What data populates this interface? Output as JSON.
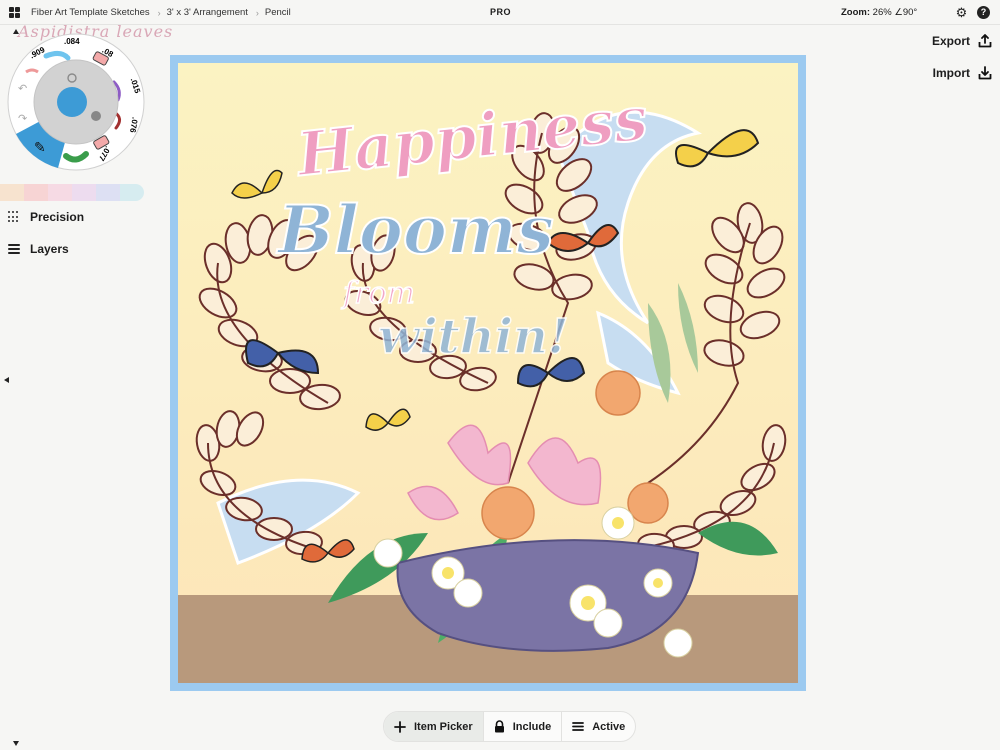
{
  "topbar": {
    "breadcrumbs": [
      "Fiber Art Template Sketches",
      "3' x 3' Arrangement",
      "Pencil"
    ],
    "badge": "PRO",
    "zoom_label": "Zoom:",
    "zoom_value": "26%",
    "rotation": "∠90°"
  },
  "toolwheel": {
    "brush_name": "Aspidistra leaves",
    "sizes": {
      "top_left": ".909",
      "top": ".084",
      "top_right": ".08",
      "right_upper": ".015",
      "right_lower": ".076",
      "bottom_right": ".077"
    }
  },
  "palette_colors": [
    "#f7e3cf",
    "#f7d4d4",
    "#f6dae4",
    "#eddcef",
    "#dde0f3",
    "#d6ecf0"
  ],
  "sidebar": {
    "precision_label": "Precision",
    "layers_label": "Layers"
  },
  "actions": {
    "export_label": "Export",
    "import_label": "Import"
  },
  "artwork": {
    "line1": "Happiness",
    "line2": "Blooms",
    "line3": "from",
    "line4": "within!"
  },
  "bottombar": {
    "item_picker": "Item Picker",
    "include": "Include",
    "active": "Active"
  },
  "colors": {
    "accent": "#3d9bd6",
    "frame": "#9ccaf0",
    "fern": "#6b2f2a"
  }
}
